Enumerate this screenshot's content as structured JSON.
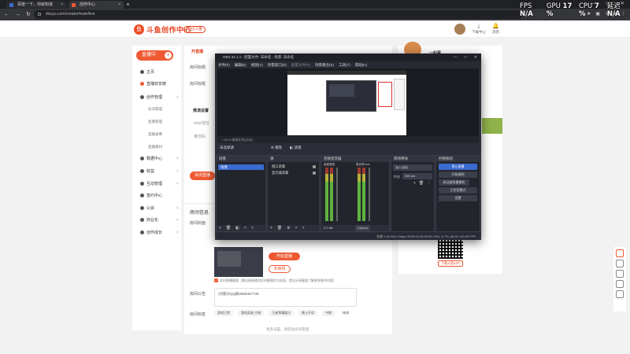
{
  "browser": {
    "tabs": [
      {
        "label": "百度一下，你就知道",
        "active": false
      },
      {
        "label": "创作中心",
        "active": true
      }
    ],
    "new_tab": "+",
    "url": "douyu.com/creator/main/live",
    "nav": {
      "back": "←",
      "forward": "→",
      "reload": "↻"
    },
    "window_controls": {
      "minimize": "—",
      "maximize": "□",
      "close": "✕"
    }
  },
  "perf_overlay": {
    "fps_label": "FPS",
    "fps_value": "N/A",
    "gpu_label": "GPU",
    "gpu_value": "17 %",
    "cpu_label": "CPU",
    "cpu_value": "7 %",
    "latency_label": "延迟",
    "latency_value": "N/A"
  },
  "site": {
    "logo_text": "斗鱼创作中心",
    "back_button": "返回斗鱼",
    "header_items": [
      {
        "icon": "download-icon",
        "label": "下载中心"
      },
      {
        "icon": "bell-icon",
        "label": "消息"
      }
    ],
    "live_button": "直播中",
    "sidebar": [
      {
        "label": "主页"
      },
      {
        "label": "直播双安链"
      },
      {
        "label": "创作管理",
        "expandable": true,
        "sub": [
          "房间管理",
          "鱼塘管理",
          "直播录像",
          "直播素材"
        ]
      },
      {
        "label": "数据中心",
        "expandable": true
      },
      {
        "label": "收益",
        "expandable": true
      },
      {
        "label": "互动管理",
        "expandable": true
      },
      {
        "label": "签约中心"
      },
      {
        "label": "公会",
        "expandable": true
      },
      {
        "label": "商业化",
        "expandable": true
      },
      {
        "label": "创作成长",
        "expandable": true
      }
    ]
  },
  "main": {
    "section_tab": "开直播",
    "broadcast_label": "开直播",
    "field_labels": [
      "房间标题",
      "房间标题"
    ],
    "stream_settings": "推流设置",
    "stream_hint": "rtmp地址",
    "stream_key": "推流码",
    "close_live_button": "关闭直播",
    "room_info": "房间信息",
    "room_label": "房间封面",
    "start_live_button": "开始直播",
    "cover_outline_button": "未审核",
    "checkbox_text": "实时直播截图（建议直接使用实时截图作为封面，提出分享截图了解更多细节内容）",
    "announce_label": "房间公告",
    "announce_value": "(对部分QQ群2809467739",
    "tags_label": "房间标签",
    "tags": [
      "游戏日常",
      "我的英雄 古城",
      "王者荣耀娱乐",
      "教士开局",
      "中期",
      "修改"
    ],
    "footer_link": "更多设置，请前往房间管理"
  },
  "right_panel": {
    "promo_title": "一起看",
    "qr_caption": "下载斗鱼APP"
  },
  "obs": {
    "title": "OBS 32.1.1 - 配置文件: 未命名 - 场景: 未命名",
    "menu": [
      "文件(F)",
      "编辑(E)",
      "视图(V)",
      "停靠窗口(D)",
      "配置文件(P)",
      "场景集合(S)",
      "工具(T)",
      "帮助(H)"
    ],
    "subbar": "○ 0%    ▾ 缩放比例(自动)",
    "tabs_left": "未选择源",
    "tab_props": "属性",
    "tab_filters": "滤镜",
    "docks": {
      "scenes": {
        "title": "场景",
        "items": [
          "场景"
        ]
      },
      "sources": {
        "title": "源",
        "items": [
          "窗口采集",
          "显示器采集"
        ]
      },
      "mixer": {
        "title": "音频混音器",
        "channels": [
          {
            "name": "桌面音频",
            "db": "0.0 dB"
          },
          {
            "name": "麦克风/Aux",
            "db": "0.0 dB"
          }
        ]
      },
      "transitions": {
        "title": "转场特效",
        "type": "淡入淡出",
        "duration_label": "时长",
        "duration_value": "300 ms"
      },
      "controls": {
        "title": "控制按钮",
        "buttons": [
          "停止直播",
          "开始录制",
          "启动虚拟摄像机",
          "工作室模式",
          "设置"
        ]
      }
    },
    "mixer_options": "Options",
    "status": "丢帧 0 (0.0%)    0 kbps    00:00:00    00:00:00    CPU: 6.7%, 60.00 / 60.00 FPS"
  },
  "colors": {
    "accent": "#ef5a33",
    "obs_bg": "#2b2e38",
    "obs_select": "#3b6ad0"
  }
}
